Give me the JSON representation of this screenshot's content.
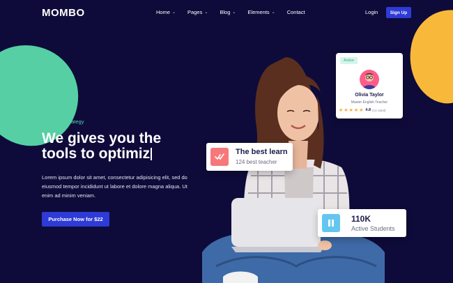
{
  "header": {
    "logo": "MOMBO",
    "nav": [
      {
        "label": "Home",
        "has_dropdown": true
      },
      {
        "label": "Pages",
        "has_dropdown": true
      },
      {
        "label": "Blog",
        "has_dropdown": true
      },
      {
        "label": "Elements",
        "has_dropdown": true
      },
      {
        "label": "Contact",
        "has_dropdown": false
      }
    ],
    "login_label": "Login",
    "signup_label": "Sign Up"
  },
  "hero": {
    "eyebrow": "Business Strategy",
    "headline_line1": "We gives you the",
    "headline_line2": "tools to optimiz",
    "paragraph": "Lorem ipsum dolor sit amet, consectetur adipisicing elit, sed do eiusmod tempor incididunt ut labore et dolore magna aliqua. Ut enim ad minim veniam.",
    "cta_label": "Purchase Now for $22"
  },
  "teacher_card": {
    "status": "Active",
    "name": "Olivia Taylor",
    "role": "Master English Teacher",
    "rating": "4.8",
    "rating_count": "(14 rated)",
    "stars": 5
  },
  "learn_card": {
    "title": "The best learn",
    "subtitle": "124 best teacher",
    "icon": "checkmark-icon"
  },
  "students_card": {
    "number": "110K",
    "label": "Active Students",
    "icon": "pause-icon"
  },
  "colors": {
    "background": "#0e0b3a",
    "accent_blue": "#2e3bd6",
    "green": "#56cfa4",
    "yellow": "#f8b93b"
  }
}
